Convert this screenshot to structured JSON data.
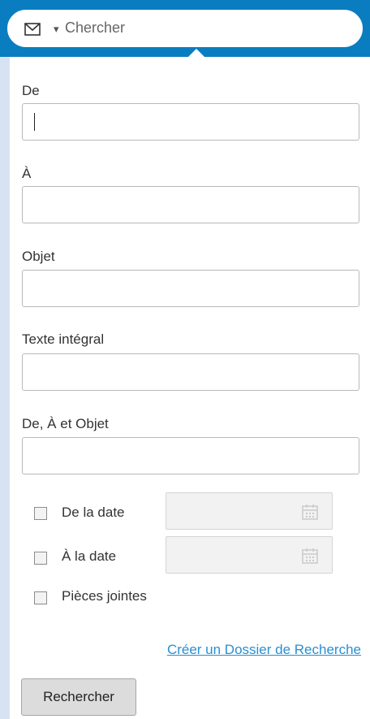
{
  "search": {
    "mail_icon": "envelope-icon",
    "caret": "▾",
    "placeholder": "Chercher"
  },
  "form": {
    "from_label": "De",
    "to_label": "À",
    "subject_label": "Objet",
    "fulltext_label": "Texte intégral",
    "all_label": "De, À et Objet",
    "from_value": "",
    "to_value": "",
    "subject_value": "",
    "fulltext_value": "",
    "all_value": ""
  },
  "filters": {
    "date_from_label": "De la date",
    "date_to_label": "À la date",
    "attachments_label": "Pièces jointes",
    "date_from_checked": false,
    "date_to_checked": false,
    "attachments_checked": false
  },
  "actions": {
    "create_folder_link": "Créer un Dossier de Recherche",
    "search_button": "Rechercher"
  },
  "colors": {
    "header_blue": "#0a7dc1",
    "link_blue": "#2a8fd0"
  }
}
